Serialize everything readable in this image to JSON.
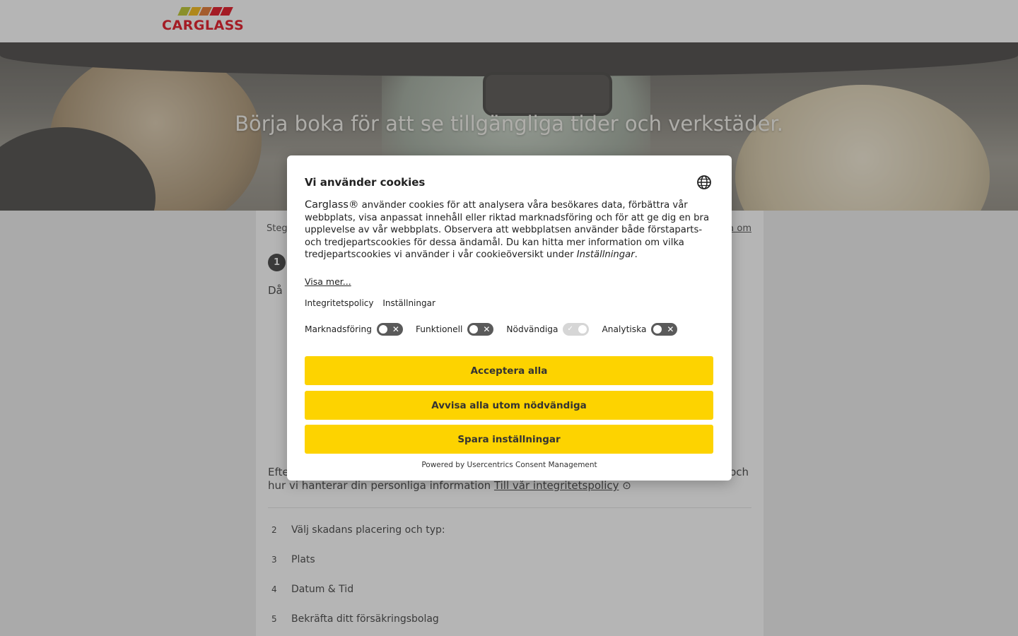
{
  "header": {
    "logo_text": "CARGLASS",
    "logo_colors": [
      "#b8c21a",
      "#f5b400",
      "#e36b1d",
      "#e3000f"
    ]
  },
  "hero": {
    "title": "Börja boka för att se tillgängliga tider och verkstäder."
  },
  "booking": {
    "steg_label": "Steg",
    "change_link": "a om",
    "step1_number": "1",
    "intro_fragment": "Då",
    "privacy_prefix": "Efte",
    "privacy_tail": "och",
    "privacy_line2": "hur vi hanterar din personliga information",
    "privacy_link": "Till vår integritetspolicy",
    "steps": [
      {
        "number": "2",
        "label": "Välj skadans placering och typ:"
      },
      {
        "number": "3",
        "label": "Plats"
      },
      {
        "number": "4",
        "label": "Datum & Tid"
      },
      {
        "number": "5",
        "label": "Bekräfta ditt försäkringsbolag"
      }
    ]
  },
  "cookie_dialog": {
    "title": "Vi använder cookies",
    "brand": "Carglass®",
    "body": " använder cookies för att analysera våra besökares data, förbättra vår webbplats, visa anpassat innehåll eller riktad marknadsföring och för att ge dig en bra upplevelse av vår webbplats. Observera att webbplatsen använder både förstaparts- och tredjepartscookies för dessa ändamål. Du kan hitta mer information om vilka tredjepartscookies vi använder i vår cookieöversikt under ",
    "body_link": "Inställningar",
    "body_end": ".",
    "show_more": "Visa mer...",
    "links": {
      "privacy": "Integritetspolicy",
      "settings": "Inställningar"
    },
    "toggles": [
      {
        "label": "Marknadsföring",
        "state": "off"
      },
      {
        "label": "Funktionell",
        "state": "off"
      },
      {
        "label": "Nödvändiga",
        "state": "on-disabled"
      },
      {
        "label": "Analytiska",
        "state": "off"
      }
    ],
    "buttons": {
      "accept_all": "Acceptera alla",
      "deny": "Avvisa alla utom nödvändiga",
      "save": "Spara inställningar"
    },
    "powered_by": "Powered by Usercentrics Consent Management",
    "button_color": "#fdd300"
  }
}
